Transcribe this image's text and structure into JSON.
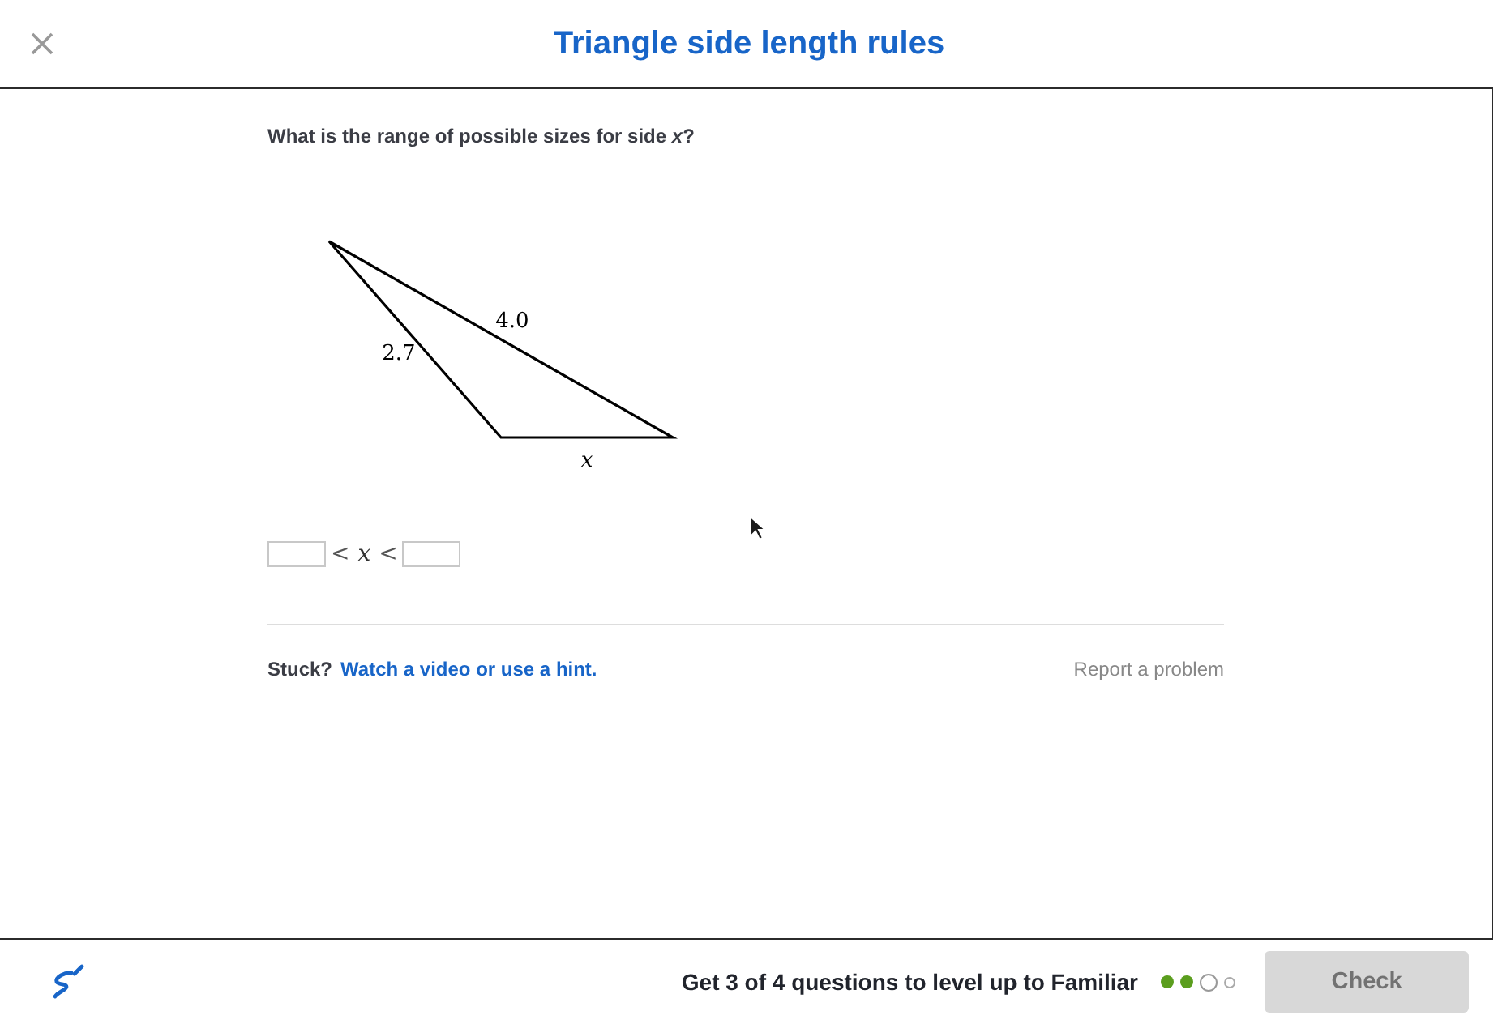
{
  "header": {
    "title": "Triangle side length rules"
  },
  "question": {
    "prompt": "What is the range of possible sizes for side *x*?",
    "figure": {
      "side_labels": [
        {
          "kind": "number",
          "text": "2.7"
        },
        {
          "kind": "number",
          "text": "4.0"
        },
        {
          "kind": "variable",
          "text": "x"
        }
      ]
    },
    "answer_row": [
      {
        "kind": "field"
      },
      {
        "kind": "symbol",
        "text": "<"
      },
      {
        "kind": "variable",
        "text": "x"
      },
      {
        "kind": "symbol",
        "text": "<"
      },
      {
        "kind": "field"
      }
    ]
  },
  "help": {
    "stuck": "Stuck?",
    "hint_link": "Watch a video or use a hint.",
    "report_link": "Report a problem"
  },
  "footer": {
    "progress_text": "Get 3 of 4 questions to level up to Familiar",
    "progress": [
      {
        "completed": true,
        "current": false
      },
      {
        "completed": true,
        "current": false
      },
      {
        "completed": false,
        "current": true
      },
      {
        "completed": false,
        "current": false
      }
    ],
    "check_button": {
      "label": "Check",
      "disabled": true
    }
  }
}
